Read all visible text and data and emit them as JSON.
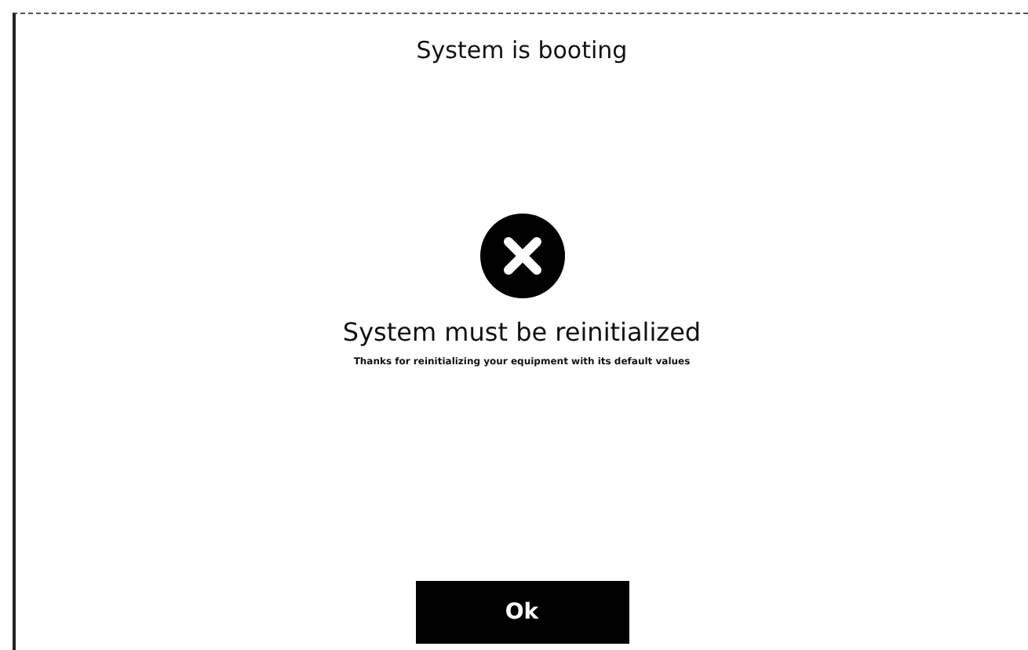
{
  "dialog": {
    "title": "System is booting",
    "message": "System must be reinitialized",
    "detail": "Thanks for reinitializing your equipment with its default values",
    "button": "Ok"
  }
}
